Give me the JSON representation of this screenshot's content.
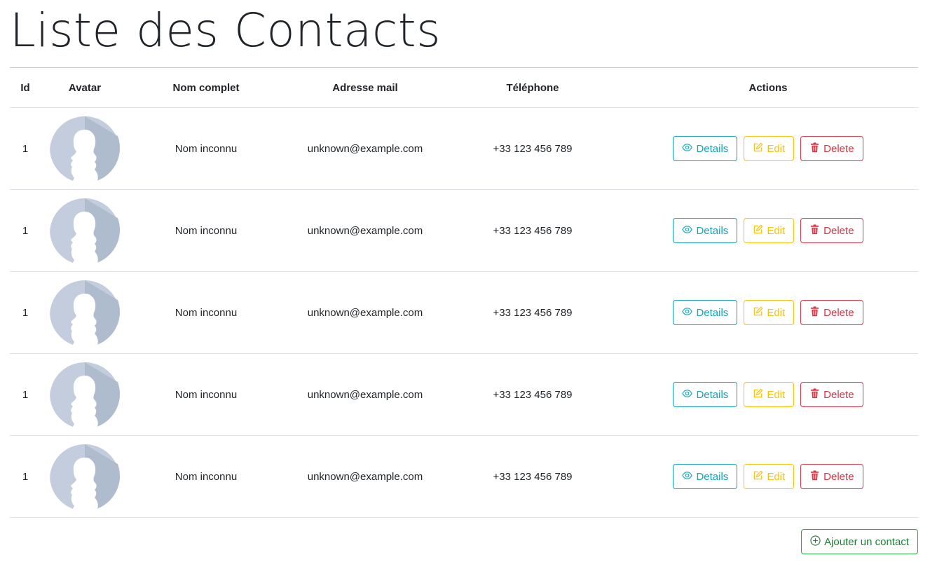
{
  "page": {
    "title": "Liste des Contacts"
  },
  "table": {
    "headers": {
      "id": "Id",
      "avatar": "Avatar",
      "name": "Nom complet",
      "email": "Adresse mail",
      "phone": "Téléphone",
      "actions": "Actions"
    },
    "rows": [
      {
        "id": "1",
        "name": "Nom inconnu",
        "email": "unknown@example.com",
        "phone": "+33 123 456 789"
      },
      {
        "id": "1",
        "name": "Nom inconnu",
        "email": "unknown@example.com",
        "phone": "+33 123 456 789"
      },
      {
        "id": "1",
        "name": "Nom inconnu",
        "email": "unknown@example.com",
        "phone": "+33 123 456 789"
      },
      {
        "id": "1",
        "name": "Nom inconnu",
        "email": "unknown@example.com",
        "phone": "+33 123 456 789"
      },
      {
        "id": "1",
        "name": "Nom inconnu",
        "email": "unknown@example.com",
        "phone": "+33 123 456 789"
      }
    ],
    "actions": {
      "details_label": "Details",
      "edit_label": "Edit",
      "delete_label": "Delete"
    }
  },
  "footer": {
    "add_label": "Ajouter un contact"
  },
  "icons": {
    "details": "eye-icon",
    "edit": "pencil-square-icon",
    "delete": "trash-icon",
    "add": "plus-circle-icon",
    "avatar": "default-avatar-icon"
  },
  "colors": {
    "info": "#17a2b8",
    "warning": "#ffc107",
    "danger": "#dc3545",
    "success": "#28a745",
    "avatar_light": "#c3cddd",
    "avatar_shadow": "#aebccd"
  }
}
